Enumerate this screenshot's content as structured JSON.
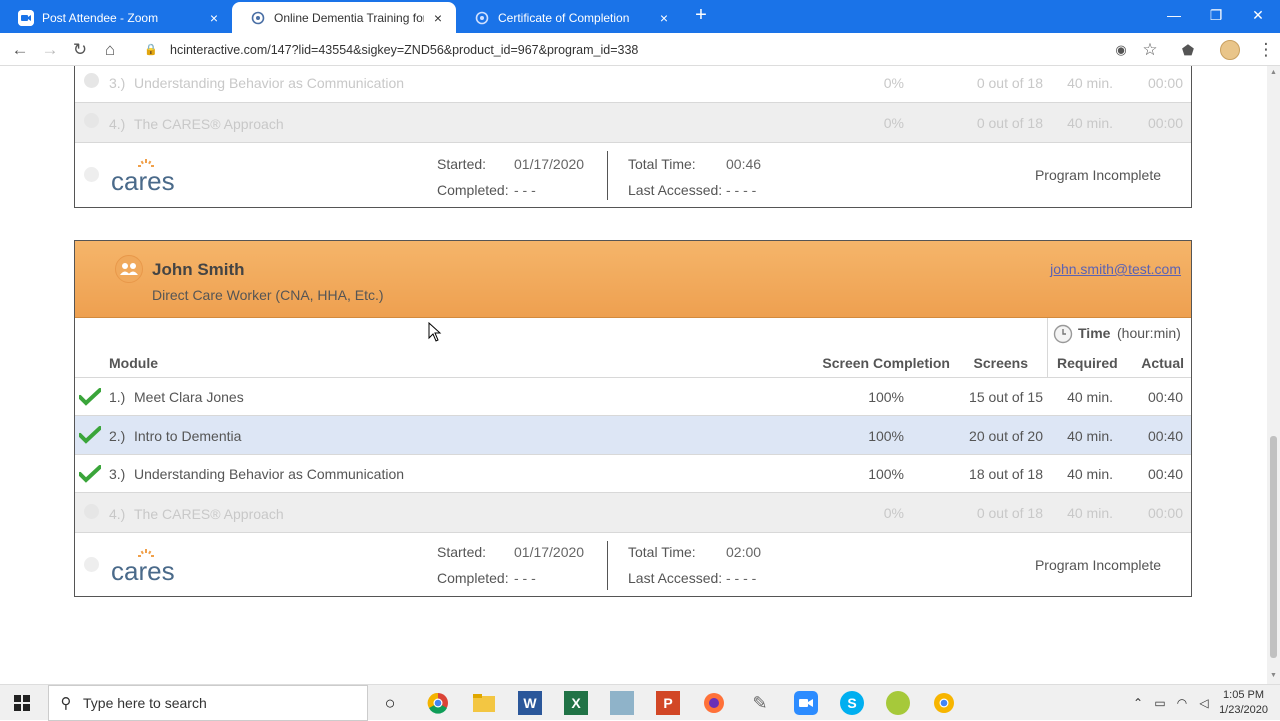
{
  "browser": {
    "tabs": [
      {
        "label": "Post Attendee - Zoom",
        "close": "×"
      },
      {
        "label": "Online Dementia Training for Ca",
        "close": "×"
      },
      {
        "label": "Certificate of Completion",
        "close": "×"
      }
    ],
    "new_tab": "+",
    "url": "hcinteractive.com/147?lid=43554&sigkey=ZND56&product_id=967&program_id=338",
    "window_controls": {
      "minimize": "—",
      "maximize": "❐",
      "close": "✕"
    }
  },
  "top_card": {
    "rows": [
      {
        "num": "3.)",
        "title": "Understanding Behavior as Communication",
        "pct": "0%",
        "screens": "0 out of 18",
        "required": "40 min.",
        "actual": "00:00"
      },
      {
        "num": "4.)",
        "title": "The CARES® Approach",
        "pct": "0%",
        "screens": "0 out of 18",
        "required": "40 min.",
        "actual": "00:00"
      }
    ],
    "footer": {
      "started_label": "Started:",
      "started": "01/17/2020",
      "completed_label": "Completed:",
      "completed": "- - -",
      "total_label": "Total Time:",
      "total": "00:46",
      "accessed_label": "Last Accessed:",
      "accessed": "- - - -",
      "status": "Program Incomplete",
      "logo": "cares"
    }
  },
  "user_card": {
    "name": "John Smith",
    "role": "Direct Care Worker (CNA, HHA, Etc.)",
    "email": "john.smith@test.com",
    "columns": {
      "module": "Module",
      "screen_completion": "Screen Completion",
      "screens": "Screens",
      "time": "Time",
      "time_unit": "(hour:min)",
      "required": "Required",
      "actual": "Actual"
    },
    "rows": [
      {
        "num": "1.)",
        "title": "Meet Clara Jones",
        "pct": "100%",
        "screens": "15 out of 15",
        "required": "40 min.",
        "actual": "00:40"
      },
      {
        "num": "2.)",
        "title": "Intro to Dementia",
        "pct": "100%",
        "screens": "20 out of 20",
        "required": "40 min.",
        "actual": "00:40"
      },
      {
        "num": "3.)",
        "title": "Understanding Behavior as Communication",
        "pct": "100%",
        "screens": "18 out of 18",
        "required": "40 min.",
        "actual": "00:40"
      },
      {
        "num": "4.)",
        "title": "The CARES® Approach",
        "pct": "0%",
        "screens": "0 out of 18",
        "required": "40 min.",
        "actual": "00:00"
      }
    ],
    "footer": {
      "started_label": "Started:",
      "started": "01/17/2020",
      "completed_label": "Completed:",
      "completed": "- - -",
      "total_label": "Total Time:",
      "total": "02:00",
      "accessed_label": "Last Accessed:",
      "accessed": "- - - -",
      "status": "Program Incomplete",
      "logo": "cares"
    }
  },
  "taskbar": {
    "search_placeholder": "Type here to search",
    "time": "1:05 PM",
    "date": "1/23/2020"
  },
  "colors": {
    "accent": "#1a73e8",
    "header_orange": "#f0a550",
    "check_green": "#3aa53a"
  }
}
